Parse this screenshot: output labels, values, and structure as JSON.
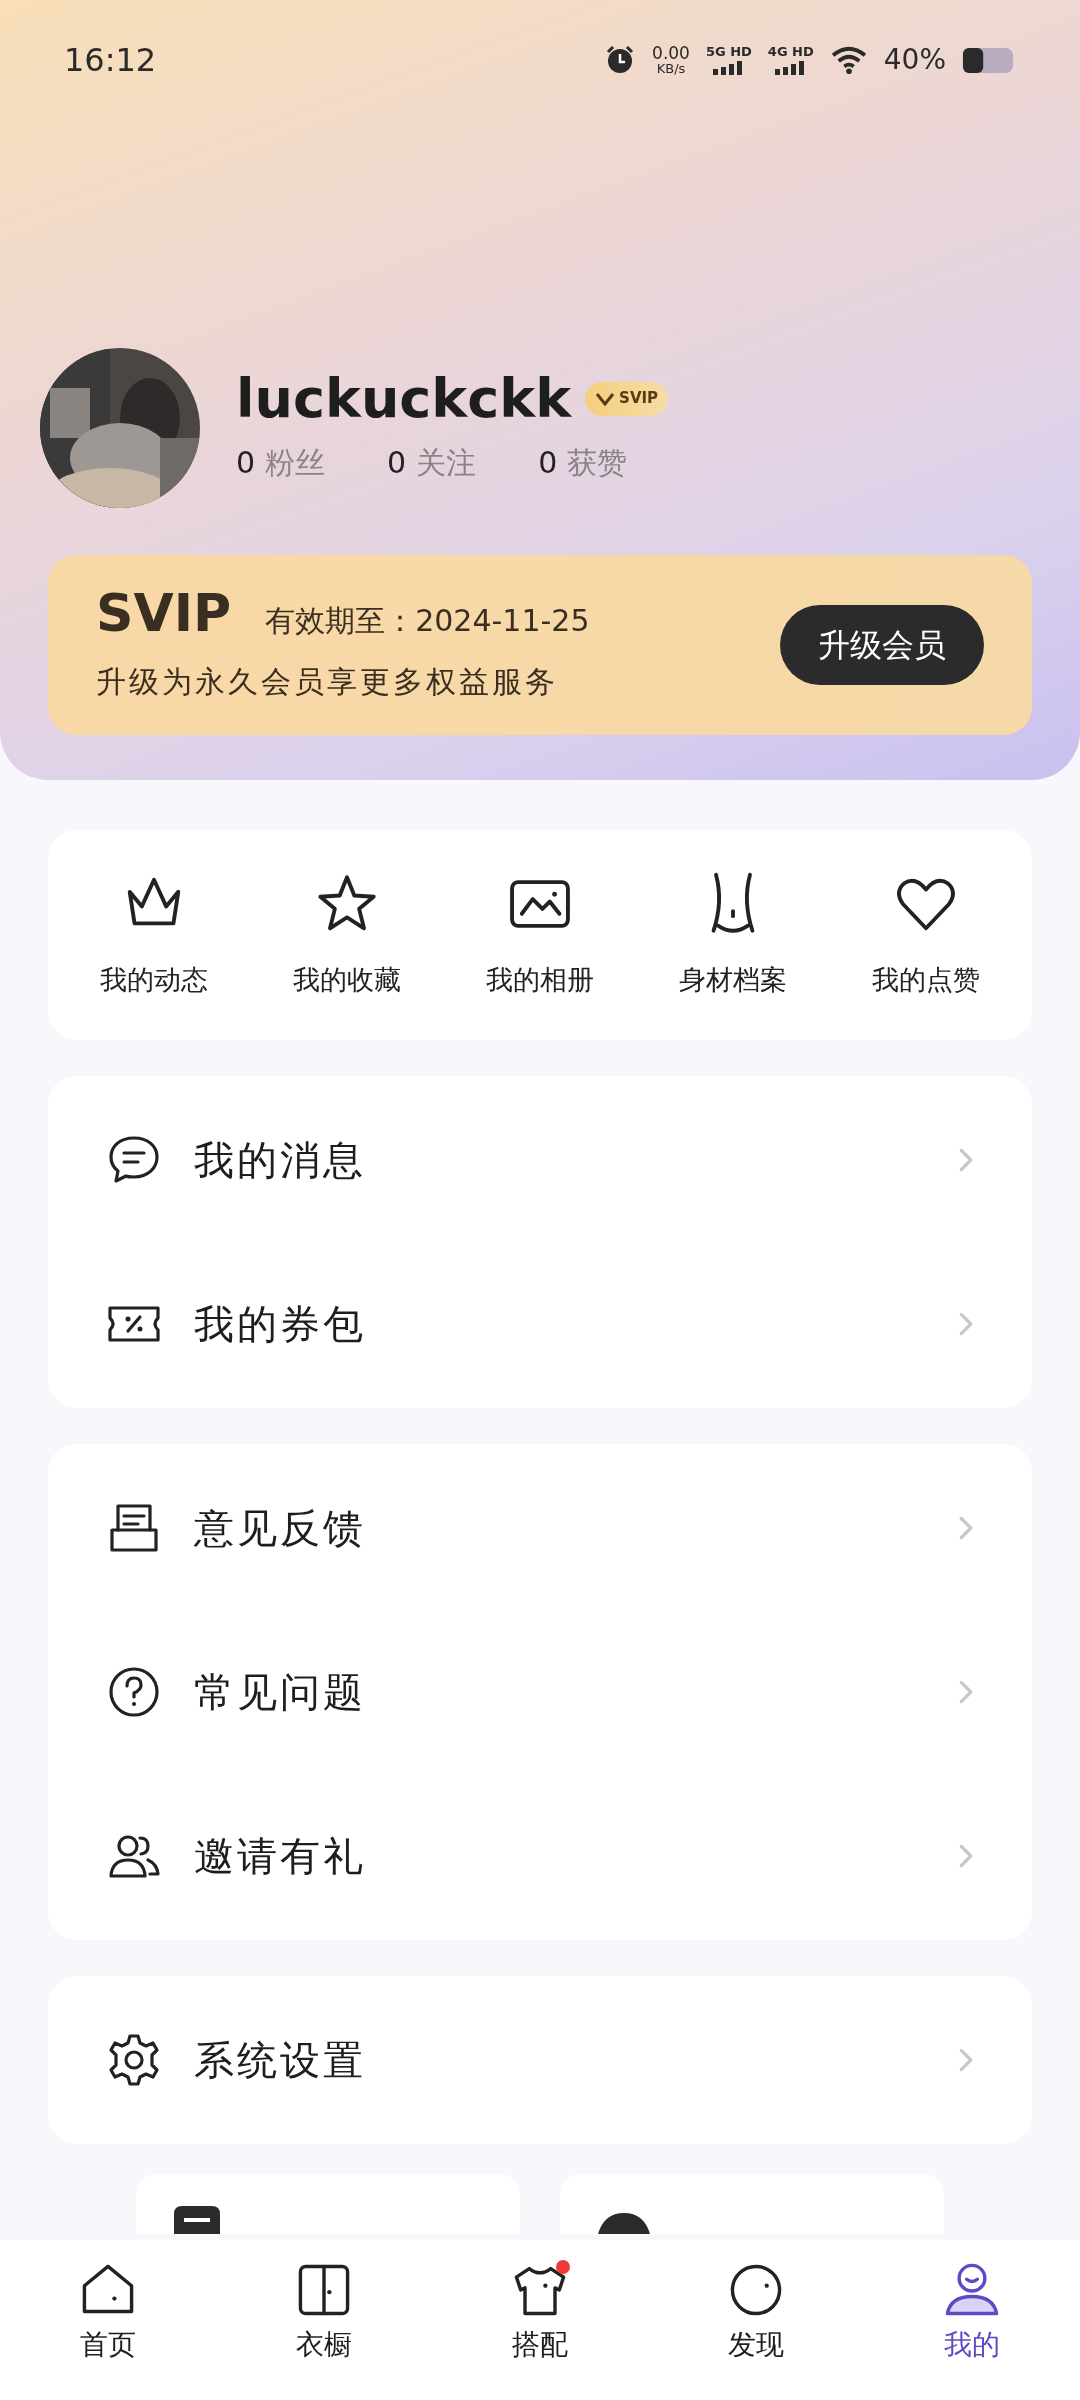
{
  "status_bar": {
    "time": "16:12",
    "speed": "0.00",
    "speed_unit": "KB/s",
    "sim1": "5G HD",
    "sim2": "4G HD",
    "battery": "40%"
  },
  "profile": {
    "username": "luckuckckk",
    "badge": "SVIP",
    "stats": [
      {
        "count": "0",
        "label": "粉丝"
      },
      {
        "count": "0",
        "label": "关注"
      },
      {
        "count": "0",
        "label": "获赞"
      }
    ]
  },
  "vip_card": {
    "title": "SVIP",
    "expiry": "有效期至：2024-11-25",
    "subtitle": "升级为永久会员享更多权益服务",
    "button": "升级会员"
  },
  "shortcuts": [
    {
      "kind": "crown",
      "label": "我的动态"
    },
    {
      "kind": "star",
      "label": "我的收藏"
    },
    {
      "kind": "album",
      "label": "我的相册"
    },
    {
      "kind": "body",
      "label": "身材档案"
    },
    {
      "kind": "heart",
      "label": "我的点赞"
    }
  ],
  "menu_groups": [
    [
      {
        "kind": "message",
        "label": "我的消息"
      },
      {
        "kind": "coupon",
        "label": "我的券包"
      }
    ],
    [
      {
        "kind": "feedback",
        "label": "意见反馈"
      },
      {
        "kind": "help",
        "label": "常见问题"
      },
      {
        "kind": "invite",
        "label": "邀请有礼"
      }
    ],
    [
      {
        "kind": "settings",
        "label": "系统设置"
      }
    ]
  ],
  "extra_cards": [
    {
      "kind": "log"
    },
    {
      "kind": "contact"
    }
  ],
  "tab_bar": [
    {
      "kind": "home",
      "label": "首页",
      "selected": false,
      "badge": false
    },
    {
      "kind": "wardrobe",
      "label": "衣橱",
      "selected": false,
      "badge": false
    },
    {
      "kind": "shirt",
      "label": "搭配",
      "selected": false,
      "badge": true
    },
    {
      "kind": "discover",
      "label": "发现",
      "selected": false,
      "badge": false
    },
    {
      "kind": "me",
      "label": "我的",
      "selected": true,
      "badge": false
    }
  ]
}
